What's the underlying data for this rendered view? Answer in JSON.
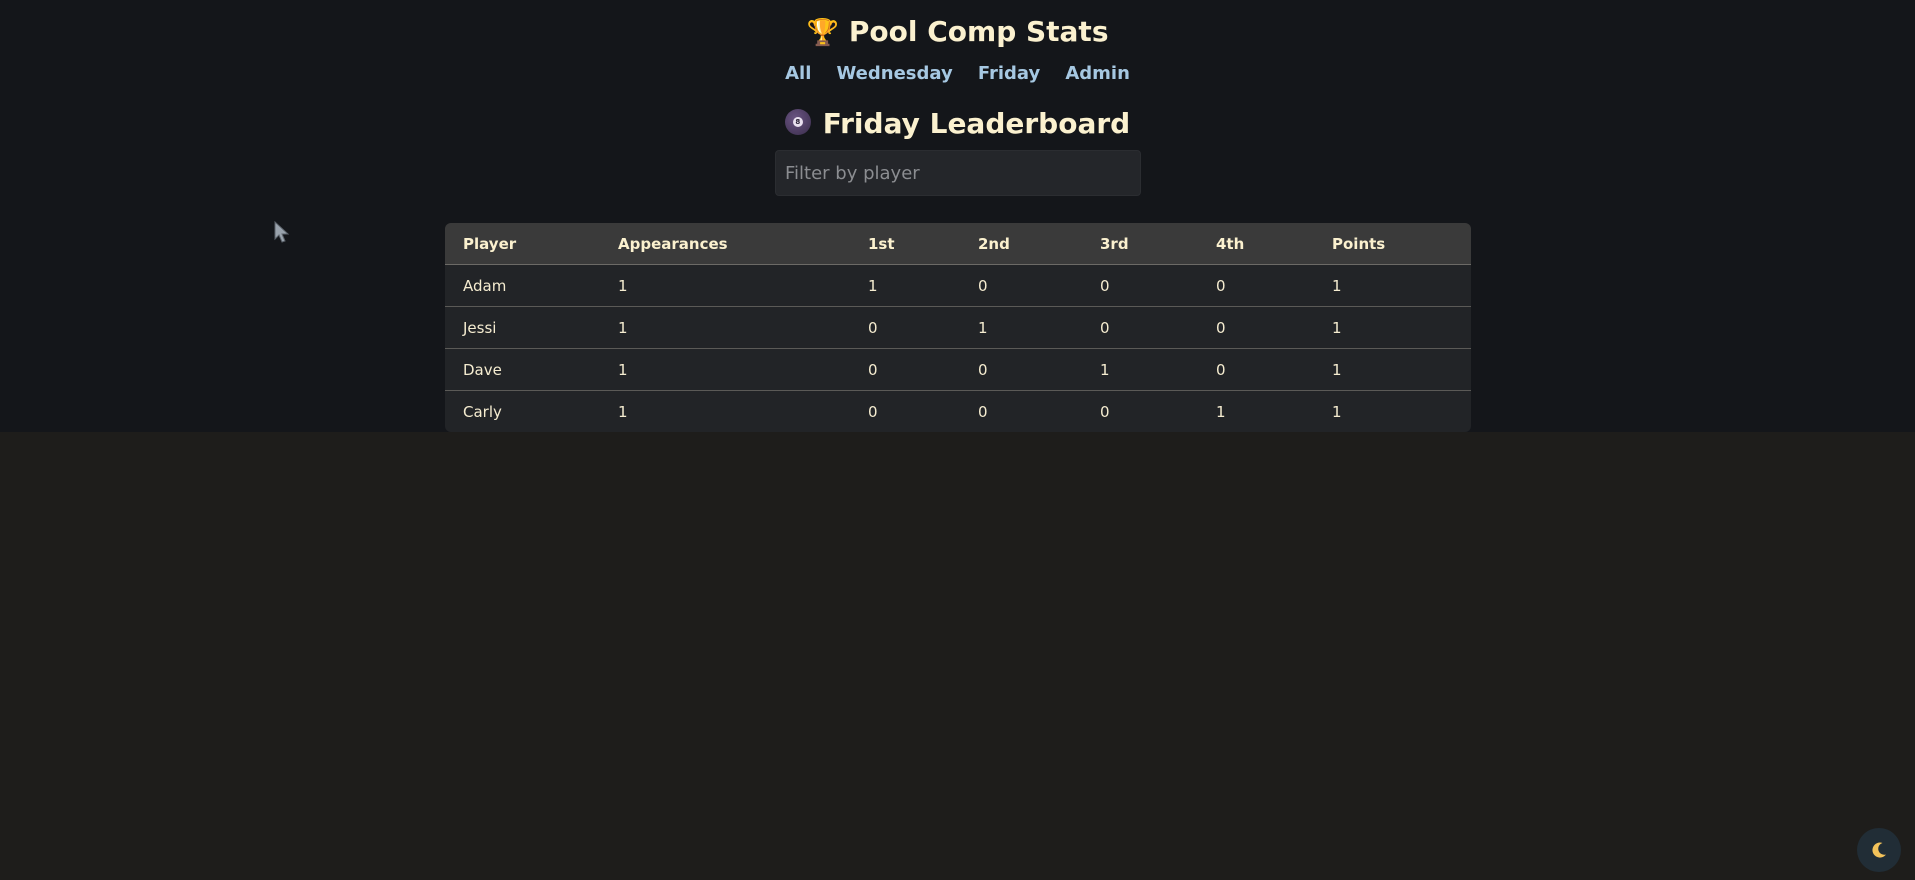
{
  "header": {
    "title": "Pool Comp Stats",
    "title_icon": "trophy-icon"
  },
  "nav": {
    "items": [
      {
        "label": "All"
      },
      {
        "label": "Wednesday"
      },
      {
        "label": "Friday"
      },
      {
        "label": "Admin"
      }
    ]
  },
  "board": {
    "title": "Friday Leaderboard",
    "icon": "eight-ball-icon",
    "ball_number": "8"
  },
  "filter": {
    "placeholder": "Filter by player",
    "value": ""
  },
  "table": {
    "columns": [
      "Player",
      "Appearances",
      "1st",
      "2nd",
      "3rd",
      "4th",
      "Points"
    ],
    "rows": [
      [
        "Adam",
        "1",
        "1",
        "0",
        "0",
        "0",
        "1"
      ],
      [
        "Jessi",
        "1",
        "0",
        "1",
        "0",
        "0",
        "1"
      ],
      [
        "Dave",
        "1",
        "0",
        "0",
        "1",
        "0",
        "1"
      ],
      [
        "Carly",
        "1",
        "0",
        "0",
        "0",
        "1",
        "1"
      ]
    ]
  },
  "theme_toggle": {
    "icon": "moon-icon"
  },
  "colors": {
    "page_background": "#1e1d1b",
    "top_background": "#14161a",
    "title_text": "#fbf1cf",
    "nav_link": "#a6c8e2",
    "table_header": "#3a3a3a",
    "table_body": "#222427"
  }
}
